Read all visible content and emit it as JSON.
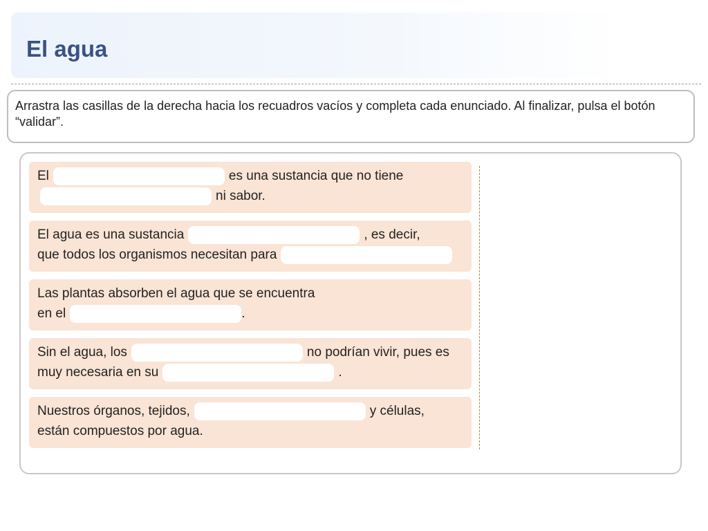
{
  "page": {
    "title": "El agua",
    "instructions": "Arrastra las casillas de la derecha hacia los recuadros vacíos y completa cada enunciado. Al finalizar, pulsa el botón “validar”."
  },
  "items": [
    {
      "t1": "El",
      "t2": "es una sustancia que no tiene",
      "t3": "ni sabor."
    },
    {
      "t1": "El agua es una sustancia",
      "t2": ", es decir,",
      "t3": "que todos los organismos necesitan para"
    },
    {
      "t1": "Las plantas absorben el agua que se encuentra",
      "t2": "en el",
      "t3": "."
    },
    {
      "t1": "Sin el agua, los",
      "t2": "no podrían vivir, pues es",
      "t3": "muy necesaria en su",
      "t4": "."
    },
    {
      "t1": "Nuestros órganos, tejidos,",
      "t2": "y células,",
      "t3": "están compuestos por agua."
    }
  ]
}
